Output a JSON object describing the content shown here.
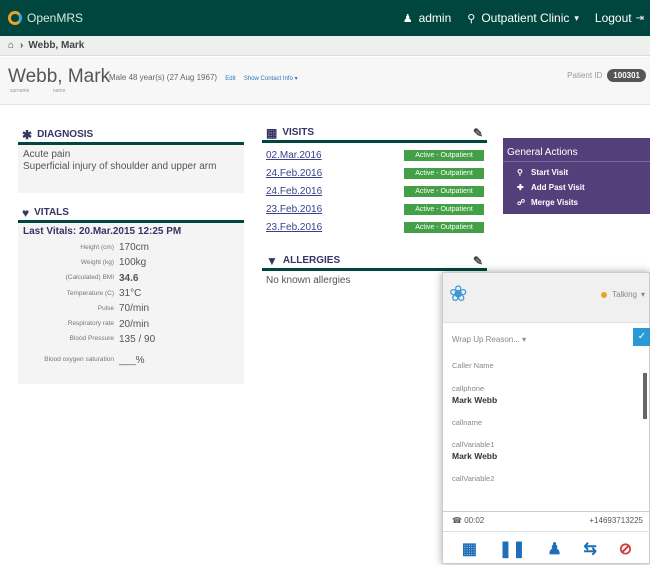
{
  "topbar": {
    "logo_text": "OpenMRS",
    "user_label": "admin",
    "location_label": "Outpatient Clinic",
    "location_caret": "▾",
    "logout_label": "Logout"
  },
  "breadcrumb": {
    "home_icon": "home-icon",
    "separator": "›",
    "current": "Webb, Mark"
  },
  "patient": {
    "name": "Webb, Mark",
    "surname_label": "surname",
    "name_label": "name",
    "info": "Male  48 year(s) (27 Aug 1967)",
    "edit_label": "Edit",
    "show_contact_label": "Show Contact Info ▾",
    "id_label": "Patient ID",
    "id_value": "100301"
  },
  "diagnosis": {
    "title": "DIAGNOSIS",
    "items": [
      "Acute pain",
      "Superficial injury of shoulder and upper arm"
    ]
  },
  "vitals": {
    "title": "VITALS",
    "last_vitals": "Last Vitals: 20.Mar.2015 12:25 PM",
    "rows": [
      {
        "label": "Height (cm)",
        "value": "170cm"
      },
      {
        "label": "Weight (kg)",
        "value": "100kg"
      },
      {
        "label": "(Calculated) BMI",
        "value": "34.6"
      },
      {
        "label": "Temperature (C)",
        "value": "31°C"
      },
      {
        "label": "Pulse",
        "value": "70/min"
      },
      {
        "label": "Respiratory rate",
        "value": "20/min"
      },
      {
        "label": "Blood Pressure",
        "value": "135 / 90"
      },
      {
        "label": "Blood oxygen saturation",
        "value": "___%"
      }
    ]
  },
  "visits": {
    "title": "VISITS",
    "rows": [
      {
        "date": "02.Mar.2016",
        "status": "Active - Outpatient"
      },
      {
        "date": "24.Feb.2016",
        "status": "Active - Outpatient"
      },
      {
        "date": "24.Feb.2016",
        "status": "Active - Outpatient"
      },
      {
        "date": "23.Feb.2016",
        "status": "Active - Outpatient"
      },
      {
        "date": "23.Feb.2016",
        "status": "Active - Outpatient"
      }
    ]
  },
  "allergies": {
    "title": "ALLERGIES",
    "text": "No known allergies"
  },
  "general_actions": {
    "title": "General Actions",
    "items": [
      "Start Visit",
      "Add Past Visit",
      "Merge Visits"
    ]
  },
  "phone": {
    "status": "Talking",
    "status_caret": "▾",
    "wrap_up": "Wrap Up Reason...  ▾",
    "check": "✓",
    "caller_name_label": "Caller Name",
    "callphone_label": "callphone",
    "callphone_value": "Mark Webb",
    "callname_label": "callname",
    "callvariable1_label": "callVariable1",
    "callvariable1_value": "Mark Webb",
    "callvariable2_label": "callVariable2",
    "timer": "00:02",
    "number": "+14693713225"
  }
}
